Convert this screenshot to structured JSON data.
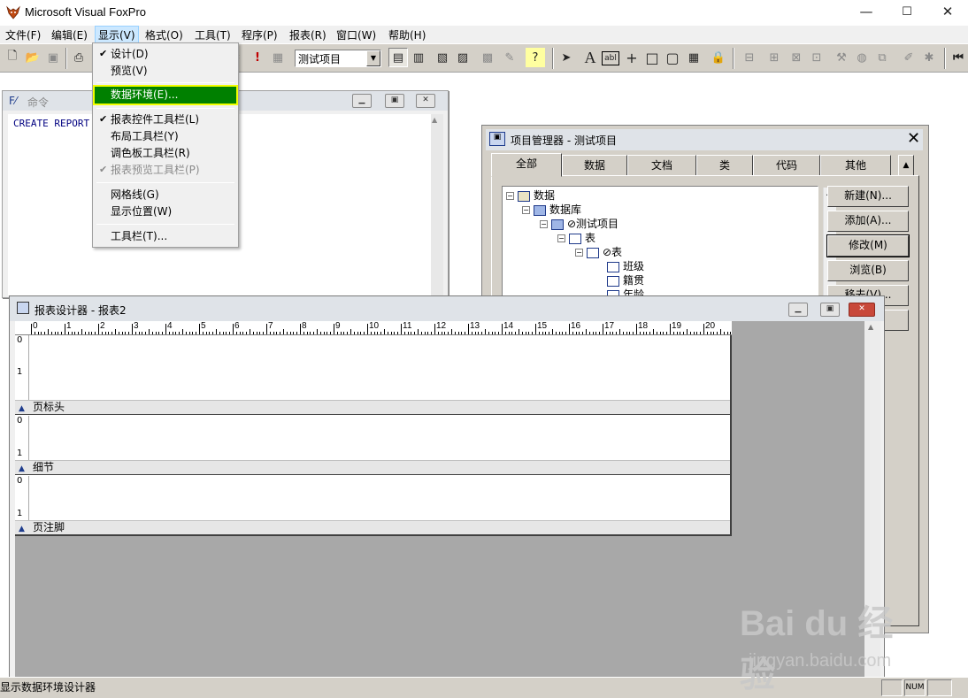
{
  "app": {
    "title": "Microsoft Visual FoxPro"
  },
  "window_controls": {
    "minimize": "—",
    "maximize": "☐",
    "close": "✕"
  },
  "menubar": {
    "items": [
      "文件(F)",
      "编辑(E)",
      "显示(V)",
      "格式(O)",
      "工具(T)",
      "程序(P)",
      "报表(R)",
      "窗口(W)",
      "帮助(H)"
    ]
  },
  "toolbar": {
    "project_combo": "测试项目"
  },
  "view_menu": {
    "items": [
      {
        "label": "设计(D)",
        "checked": "✔",
        "disabled": false
      },
      {
        "label": "预览(V)",
        "checked": "",
        "disabled": false
      },
      {
        "label": "数据环境(E)...",
        "checked": "",
        "disabled": false,
        "highlighted": true
      },
      {
        "label": "报表控件工具栏(L)",
        "checked": "✔",
        "disabled": false
      },
      {
        "label": "布局工具栏(Y)",
        "checked": "",
        "disabled": false
      },
      {
        "label": "调色板工具栏(R)",
        "checked": "",
        "disabled": false
      },
      {
        "label": "报表预览工具栏(P)",
        "checked": "✔",
        "disabled": true
      },
      {
        "label": "网格线(G)",
        "checked": "",
        "disabled": false
      },
      {
        "label": "显示位置(W)",
        "checked": "",
        "disabled": false
      },
      {
        "label": "工具栏(T)...",
        "checked": "",
        "disabled": false
      }
    ]
  },
  "command_window": {
    "title": "命令",
    "content": "CREATE REPORT"
  },
  "project_manager": {
    "title": "项目管理器 - 测试项目",
    "tabs": [
      "全部",
      "数据",
      "文档",
      "类",
      "代码",
      "其他"
    ],
    "tree": [
      {
        "label": "数据",
        "level": 0,
        "expander": "−"
      },
      {
        "label": "数据库",
        "level": 1,
        "expander": "−"
      },
      {
        "label": "⊘测试项目",
        "level": 2,
        "expander": "−"
      },
      {
        "label": "表",
        "level": 3,
        "expander": "−"
      },
      {
        "label": "⊘表",
        "level": 4,
        "expander": "−"
      },
      {
        "label": "班级",
        "level": 5,
        "expander": ""
      },
      {
        "label": "籍贯",
        "level": 5,
        "expander": ""
      },
      {
        "label": "年龄",
        "level": 5,
        "expander": ""
      }
    ],
    "buttons": [
      "新建(N)...",
      "添加(A)...",
      "修改(M)",
      "浏览(B)",
      "移去(V)...",
      ""
    ]
  },
  "report_designer": {
    "title": "报表设计器 - 报表2",
    "ruler": [
      "0",
      "1",
      "2",
      "3",
      "4",
      "5",
      "6",
      "7",
      "8",
      "9",
      "10",
      "11",
      "12",
      "13",
      "14",
      "15",
      "16",
      "17",
      "18",
      "19",
      "20"
    ],
    "vruler": [
      "0",
      "1"
    ],
    "bands": [
      "页标头",
      "细节",
      "页注脚"
    ]
  },
  "statusbar": {
    "text": "显示数据环境设计器",
    "num": "NUM"
  },
  "watermark": {
    "logo": "Bai du 经验",
    "url": "jingyan.baidu.com"
  }
}
